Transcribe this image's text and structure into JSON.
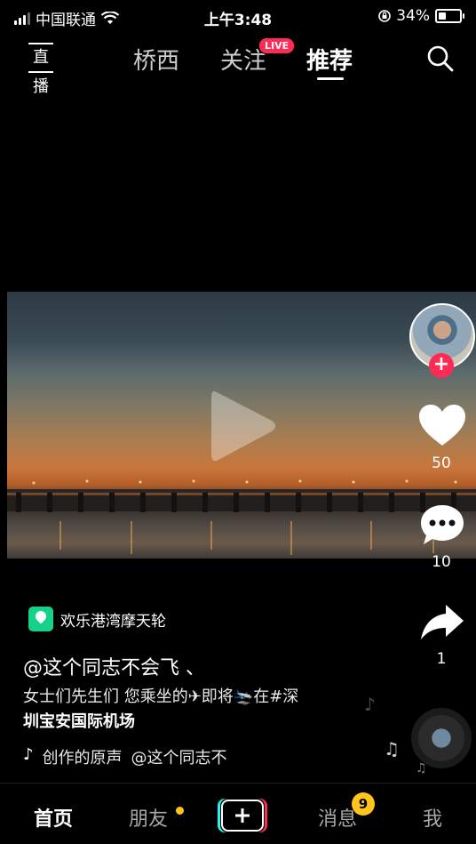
{
  "status_bar": {
    "carrier": "中国联通",
    "time": "上午3:48",
    "battery": "34%",
    "icons": [
      "signal-icon",
      "wifi-icon",
      "orientation-lock-icon",
      "battery-icon"
    ]
  },
  "top_nav": {
    "live_label": "直播",
    "tabs": [
      {
        "label": "桥西",
        "active": false
      },
      {
        "label": "关注",
        "active": false,
        "badge": "LIVE"
      },
      {
        "label": "推荐",
        "active": true
      }
    ],
    "search_icon": "search-icon"
  },
  "video": {
    "state": "paused",
    "play_icon": "play-icon"
  },
  "side_actions": {
    "follow_icon": "plus-icon",
    "likes": "50",
    "comments": "10",
    "shares": "1"
  },
  "post": {
    "location": "欢乐港湾摩天轮",
    "author": "@这个同志不会飞 、",
    "description_line1": "女士们先生们 您乘坐的✈即将🛬在#深",
    "description_line2": "圳宝安国际机场",
    "music_label": "创作的原声",
    "music_author": "@这个同志不"
  },
  "bottom_nav": {
    "items": [
      "首页",
      "朋友",
      "消息",
      "我"
    ],
    "active": "首页",
    "message_badge": "9",
    "create_icon": "plus-icon"
  },
  "colors": {
    "accent": "#fe2c55",
    "badge_yellow": "#ffc51a",
    "location_green": "#16d18a",
    "background": "#000000"
  }
}
